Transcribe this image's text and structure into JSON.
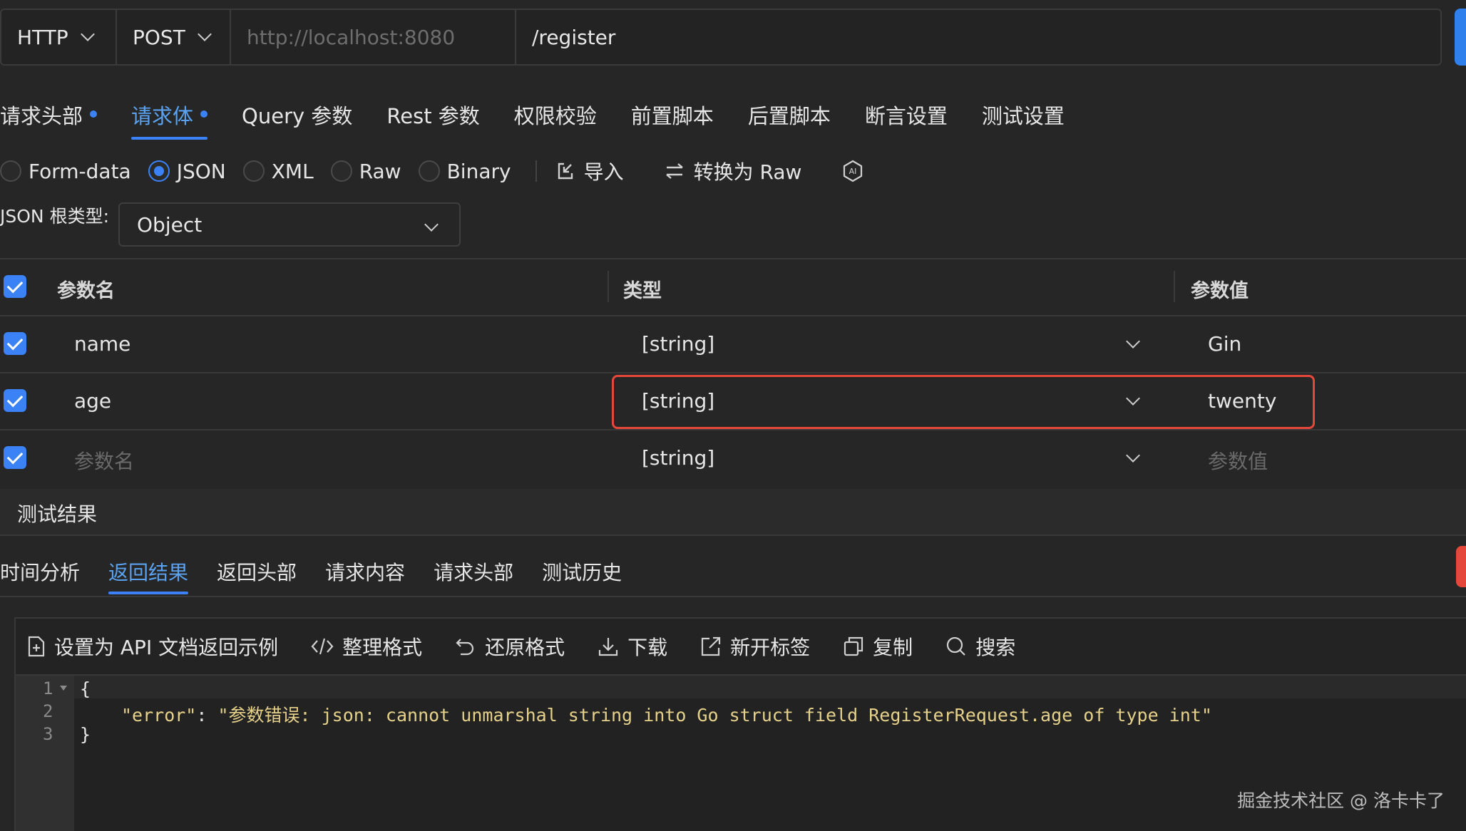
{
  "url_bar": {
    "protocol": "HTTP",
    "method": "POST",
    "base_url_placeholder": "http://localhost:8080",
    "path": "/register"
  },
  "request_tabs": [
    {
      "label": "请求头部",
      "dot": true
    },
    {
      "label": "请求体",
      "dot": true,
      "active": true
    },
    {
      "label": "Query 参数"
    },
    {
      "label": "Rest 参数"
    },
    {
      "label": "权限校验"
    },
    {
      "label": "前置脚本"
    },
    {
      "label": "后置脚本"
    },
    {
      "label": "断言设置"
    },
    {
      "label": "测试设置"
    }
  ],
  "body_types": {
    "form_data": "Form-data",
    "json": "JSON",
    "xml": "XML",
    "raw": "Raw",
    "binary": "Binary",
    "import": "导入",
    "convert": "转换为 Raw",
    "ai_icon_text": "AI"
  },
  "root_type": {
    "label": "JSON 根类型:",
    "value": "Object"
  },
  "params_table": {
    "headers": {
      "name": "参数名",
      "type": "类型",
      "value": "参数值"
    },
    "rows": [
      {
        "name": "name",
        "type": "[string]",
        "value": "Gin"
      },
      {
        "name": "age",
        "type": "[string]",
        "value": "twenty"
      }
    ],
    "new_row": {
      "name_placeholder": "参数名",
      "type": "[string]",
      "value_placeholder": "参数值"
    }
  },
  "results": {
    "title": "测试结果",
    "tabs": [
      "时间分析",
      "返回结果",
      "返回头部",
      "请求内容",
      "请求头部",
      "测试历史"
    ],
    "active_tab": "返回结果"
  },
  "editor_toolbar": {
    "set_example": "设置为 API 文档返回示例",
    "format": "整理格式",
    "restore": "还原格式",
    "download": "下载",
    "new_tab": "新开标签",
    "copy": "复制",
    "search": "搜索"
  },
  "response": {
    "line_numbers": [
      "1",
      "2",
      "3"
    ],
    "line1": "{",
    "key": "\"error\"",
    "colon": ": ",
    "value": "\"参数错误: json: cannot unmarshal string into Go struct field RegisterRequest.age of type int\"",
    "line3": "}"
  },
  "watermark": "掘金技术社区 @ 洛卡卡了"
}
